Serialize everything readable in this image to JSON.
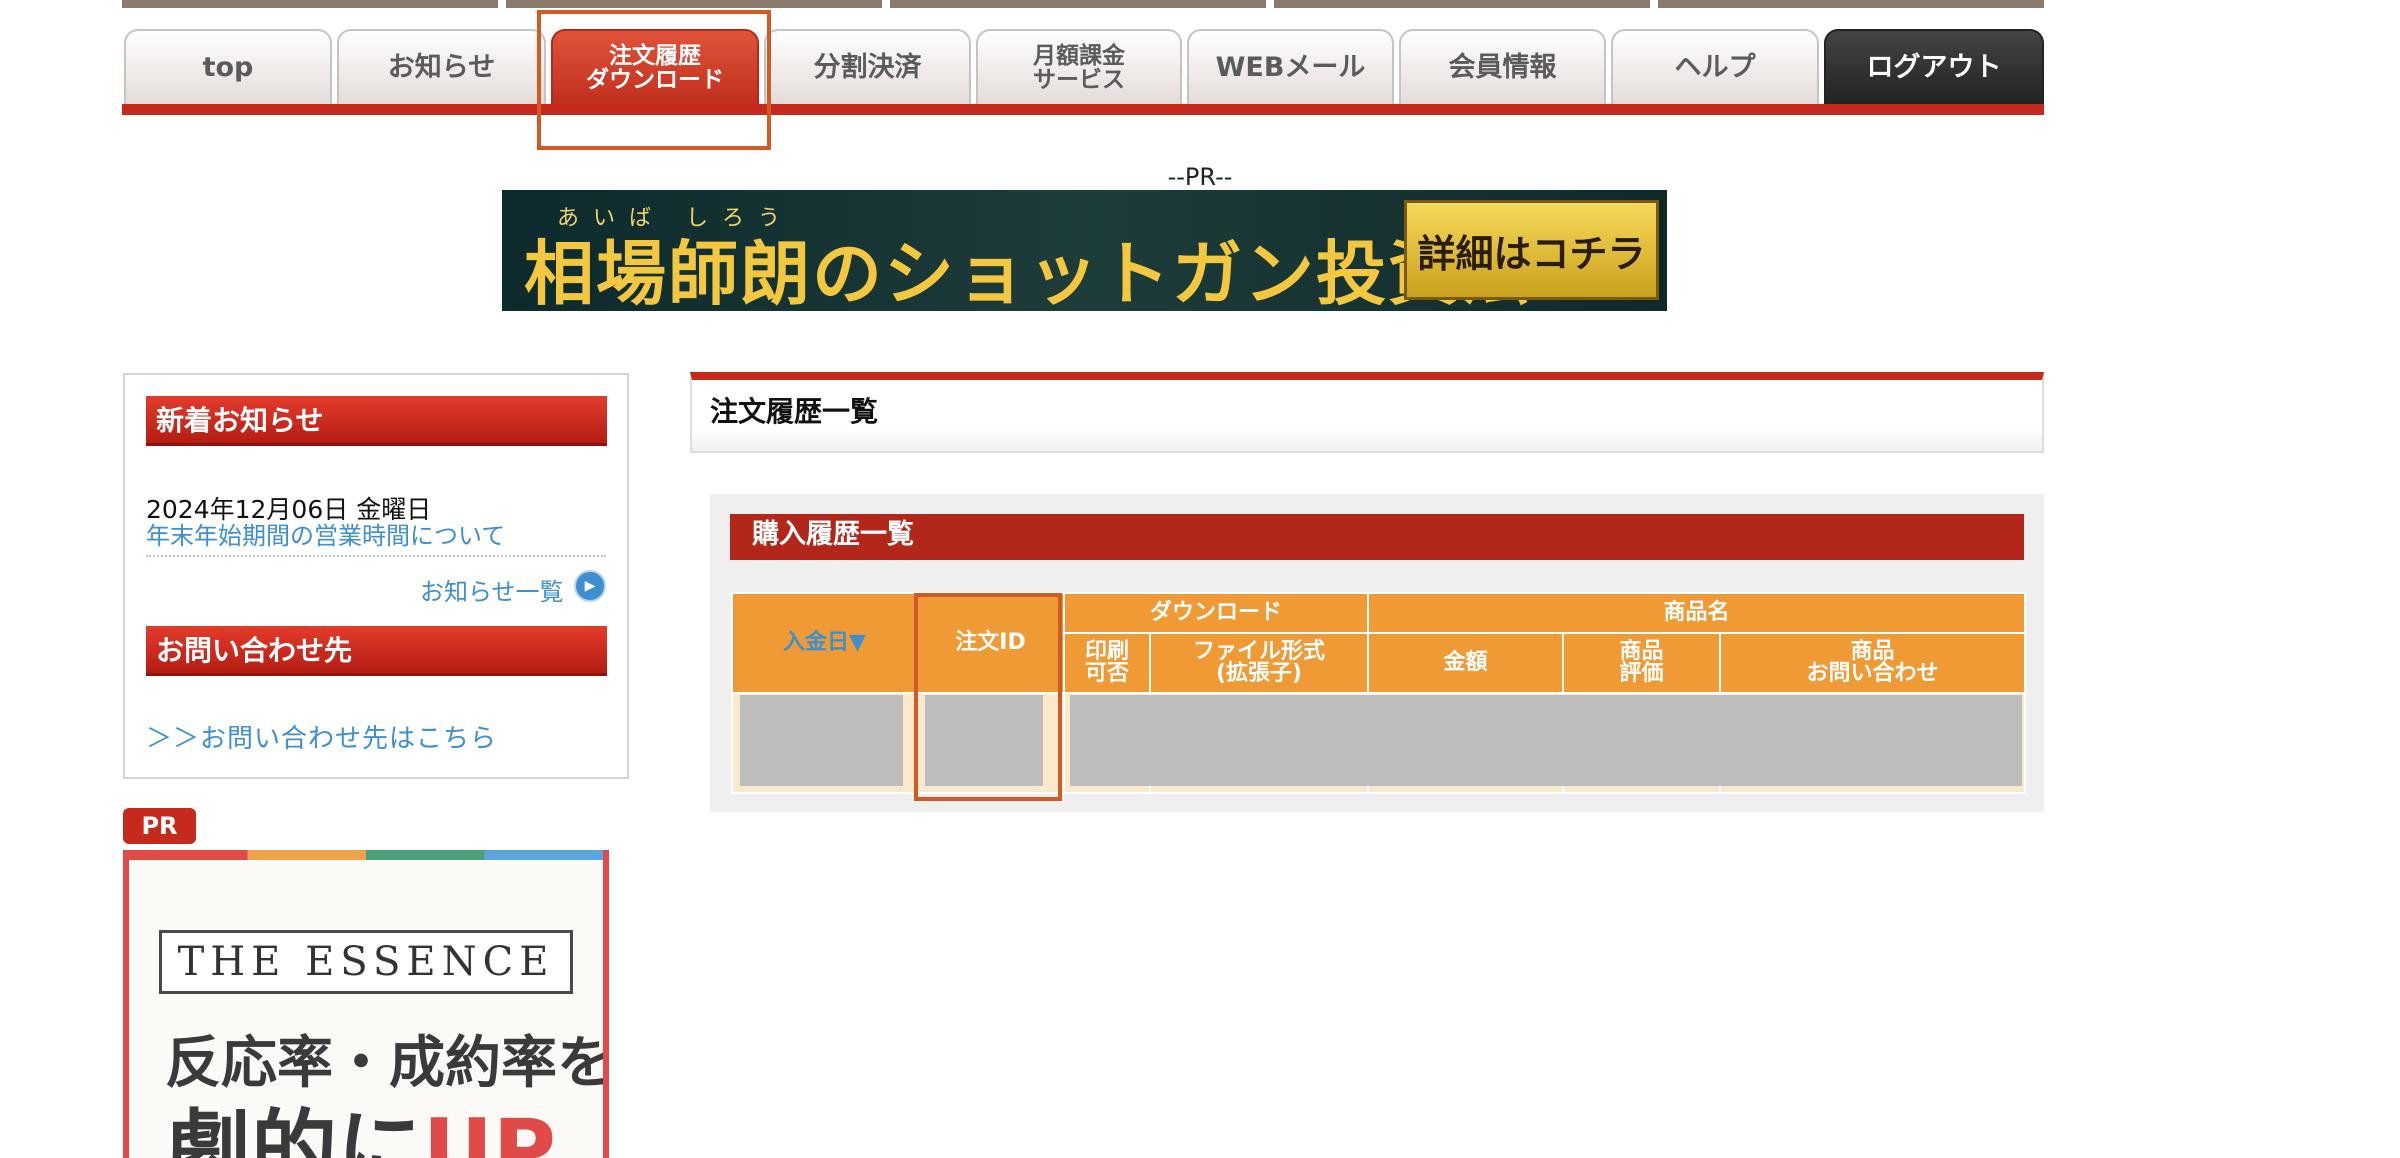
{
  "nav": {
    "tabs": [
      {
        "label": "top"
      },
      {
        "label": "お知らせ"
      },
      {
        "label": "注文履歴\nダウンロード"
      },
      {
        "label": "分割決済"
      },
      {
        "label": "月額課金\nサービス"
      },
      {
        "label": "WEBメール"
      },
      {
        "label": "会員情報"
      },
      {
        "label": "ヘルプ"
      },
      {
        "label": "ログアウト"
      }
    ]
  },
  "banner": {
    "pr_label": "--PR--",
    "ruby": "あいば しろう",
    "title": "相場師朗のショットガン投資法",
    "button": "詳細はコチラ"
  },
  "sidebar": {
    "news_heading": "新着お知らせ",
    "news_date": "2024年12月06日 金曜日",
    "news_link": "年末年始期間の営業時間について",
    "news_all": "お知らせ一覧",
    "contact_heading": "お問い合わせ先",
    "contact_link": "＞＞お問い合わせ先はこちら"
  },
  "ad": {
    "badge": "PR",
    "essence": "THE ESSENCE",
    "line1": "反応率・成約率を",
    "line2_prefix": "劇的に",
    "line2_up": "UP"
  },
  "main": {
    "title": "注文履歴一覧",
    "panel_heading": "購入履歴一覧",
    "table": {
      "col_date": "入金日▼",
      "col_order_id": "注文ID",
      "col_download": "ダウンロード",
      "col_product_name": "商品名",
      "col_print": "印刷\n可否",
      "col_format": "ファイル形式\n(拡張子)",
      "col_amount": "金額",
      "col_rating": "商品\n評価",
      "col_inquiry": "商品\nお問い合わせ"
    }
  },
  "colors": {
    "accent_red": "#c62a1c",
    "table_header_orange": "#f09a35",
    "link_blue": "#3d8fd0",
    "highlight_orange": "#d25a24"
  }
}
